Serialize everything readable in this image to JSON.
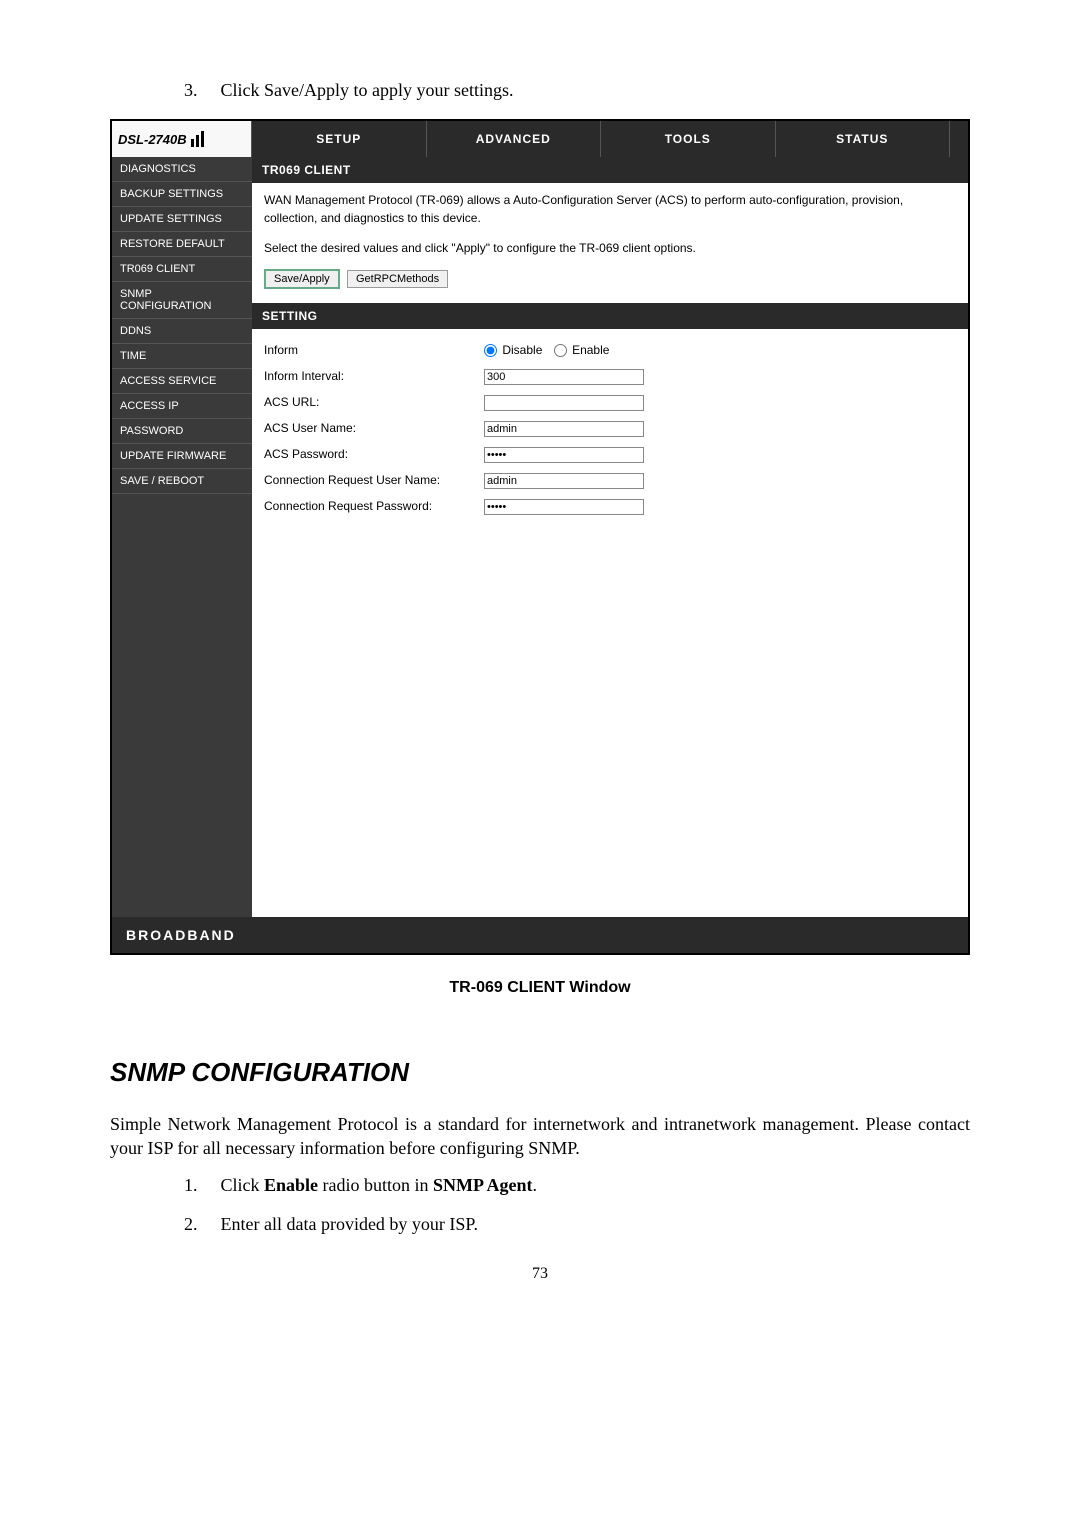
{
  "step_top": {
    "num": "3.",
    "text": "Click Save/Apply to apply your settings."
  },
  "router": {
    "model": "DSL-2740B",
    "tabs": [
      "SETUP",
      "ADVANCED",
      "TOOLS",
      "STATUS"
    ],
    "sidebar": [
      "DIAGNOSTICS",
      "BACKUP SETTINGS",
      "UPDATE SETTINGS",
      "RESTORE DEFAULT",
      "TR069 CLIENT",
      "SNMP CONFIGURATION",
      "DDNS",
      "TIME",
      "ACCESS SERVICE",
      "ACCESS IP",
      "PASSWORD",
      "UPDATE FIRMWARE",
      "SAVE / REBOOT"
    ],
    "panel1": {
      "title": "TR069 CLIENT",
      "desc1": "WAN Management Protocol (TR-069) allows a Auto-Configuration Server (ACS) to perform auto-configuration, provision, collection, and diagnostics to this device.",
      "desc2": "Select the desired values and click \"Apply\" to configure the TR-069 client options.",
      "btn_save": "Save/Apply",
      "btn_rpc": "GetRPCMethods"
    },
    "panel2": {
      "title": "SETTING",
      "inform_label": "Inform",
      "radio_disable": "Disable",
      "radio_enable": "Enable",
      "rows": {
        "interval_label": "Inform Interval:",
        "interval_value": "300",
        "acs_url_label": "ACS URL:",
        "acs_url_value": "",
        "acs_user_label": "ACS User Name:",
        "acs_user_value": "admin",
        "acs_pass_label": "ACS Password:",
        "acs_pass_value": "•••••",
        "cr_user_label": "Connection Request User Name:",
        "cr_user_value": "admin",
        "cr_pass_label": "Connection Request Password:",
        "cr_pass_value": "•••••"
      }
    },
    "footer": "BROADBAND"
  },
  "caption": "TR-069 CLIENT Window",
  "section_heading": "SNMP CONFIGURATION",
  "body_para": "Simple Network Management Protocol is a standard for internetwork and intranetwork management. Please contact your ISP for all necessary information before configuring SNMP.",
  "steps": {
    "s1_num": "1.",
    "s1_a": "Click ",
    "s1_b": "Enable",
    "s1_c": " radio button in ",
    "s1_d": "SNMP Agent",
    "s1_e": ".",
    "s2_num": "2.",
    "s2_text": "Enter all data provided by your ISP."
  },
  "page_number": "73",
  "chart_data": null
}
